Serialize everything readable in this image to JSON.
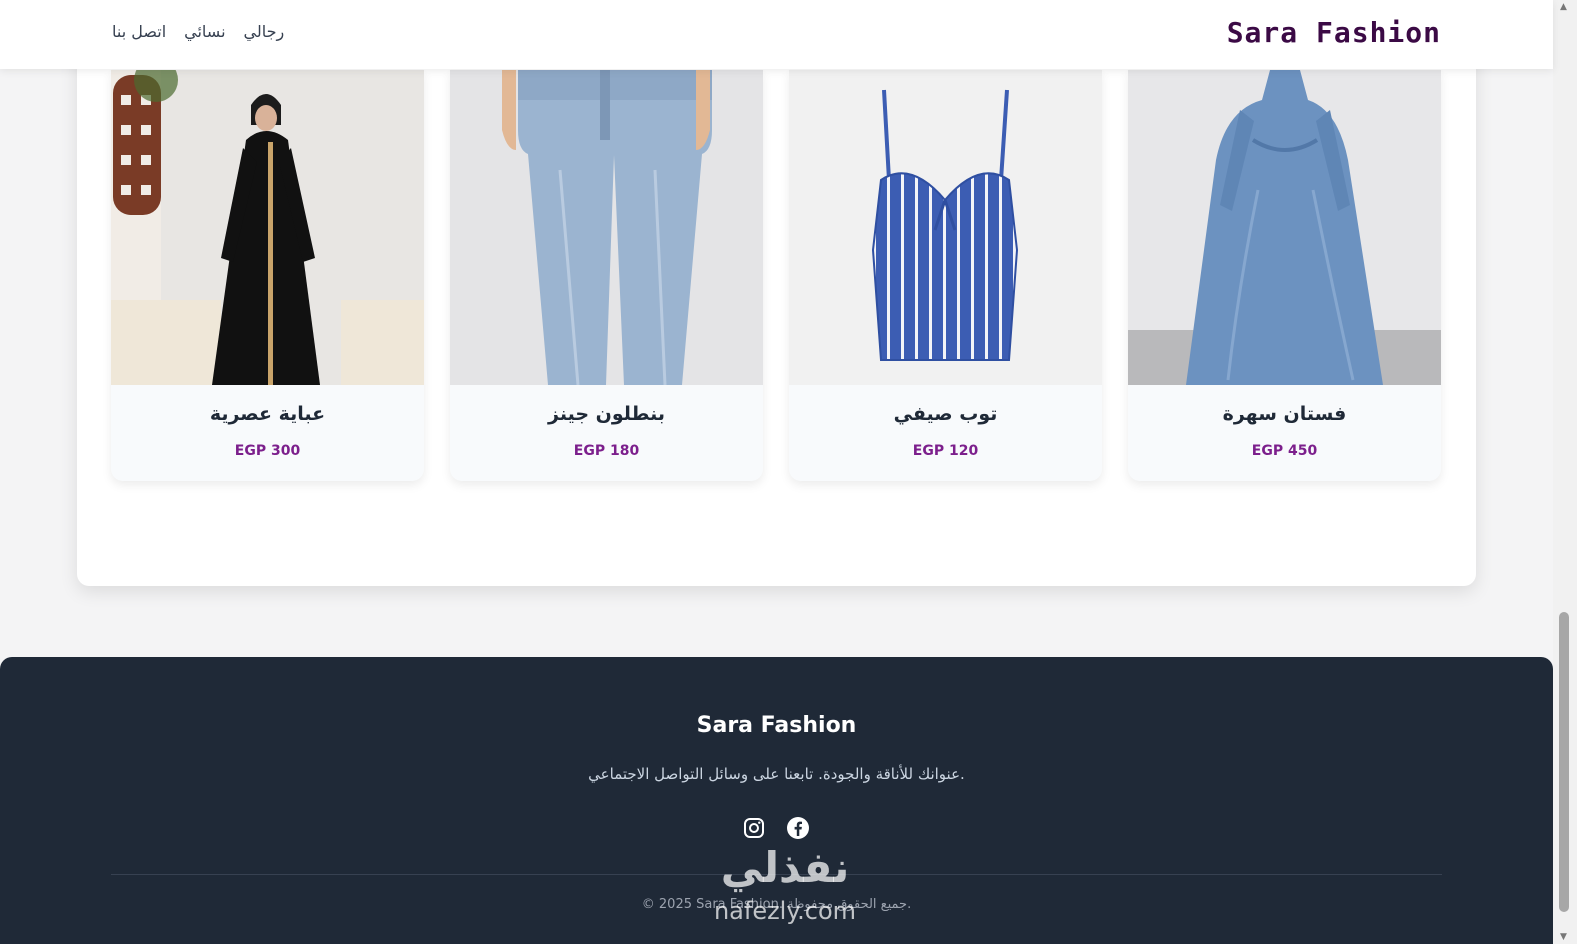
{
  "header": {
    "brand": "Sara Fashion",
    "nav": [
      "رجالي",
      "نسائي",
      "اتصل بنا"
    ]
  },
  "products": [
    {
      "name": "فستان سهرة",
      "price": "EGP 450",
      "image_icon": "evening-dress-image"
    },
    {
      "name": "توب صيفي",
      "price": "EGP 120",
      "image_icon": "summer-top-image"
    },
    {
      "name": "بنطلون جينز",
      "price": "EGP 180",
      "image_icon": "jeans-image"
    },
    {
      "name": "عباية عصرية",
      "price": "EGP 300",
      "image_icon": "abaya-image"
    }
  ],
  "footer": {
    "brand": "Sara Fashion",
    "tagline": "عنوانك للأناقة والجودة. تابعنا على وسائل التواصل الاجتماعي.",
    "socials": [
      "facebook-icon",
      "instagram-icon"
    ],
    "copyright": "© 2025 Sara Fashion. جميع الحقوق محفوظة."
  },
  "watermark": {
    "arabic": "نفذلي",
    "latin": "nafezly.com"
  },
  "colors": {
    "brand": "#3b0a45",
    "price": "#7c1f8c",
    "footer_bg": "#1f2937"
  }
}
